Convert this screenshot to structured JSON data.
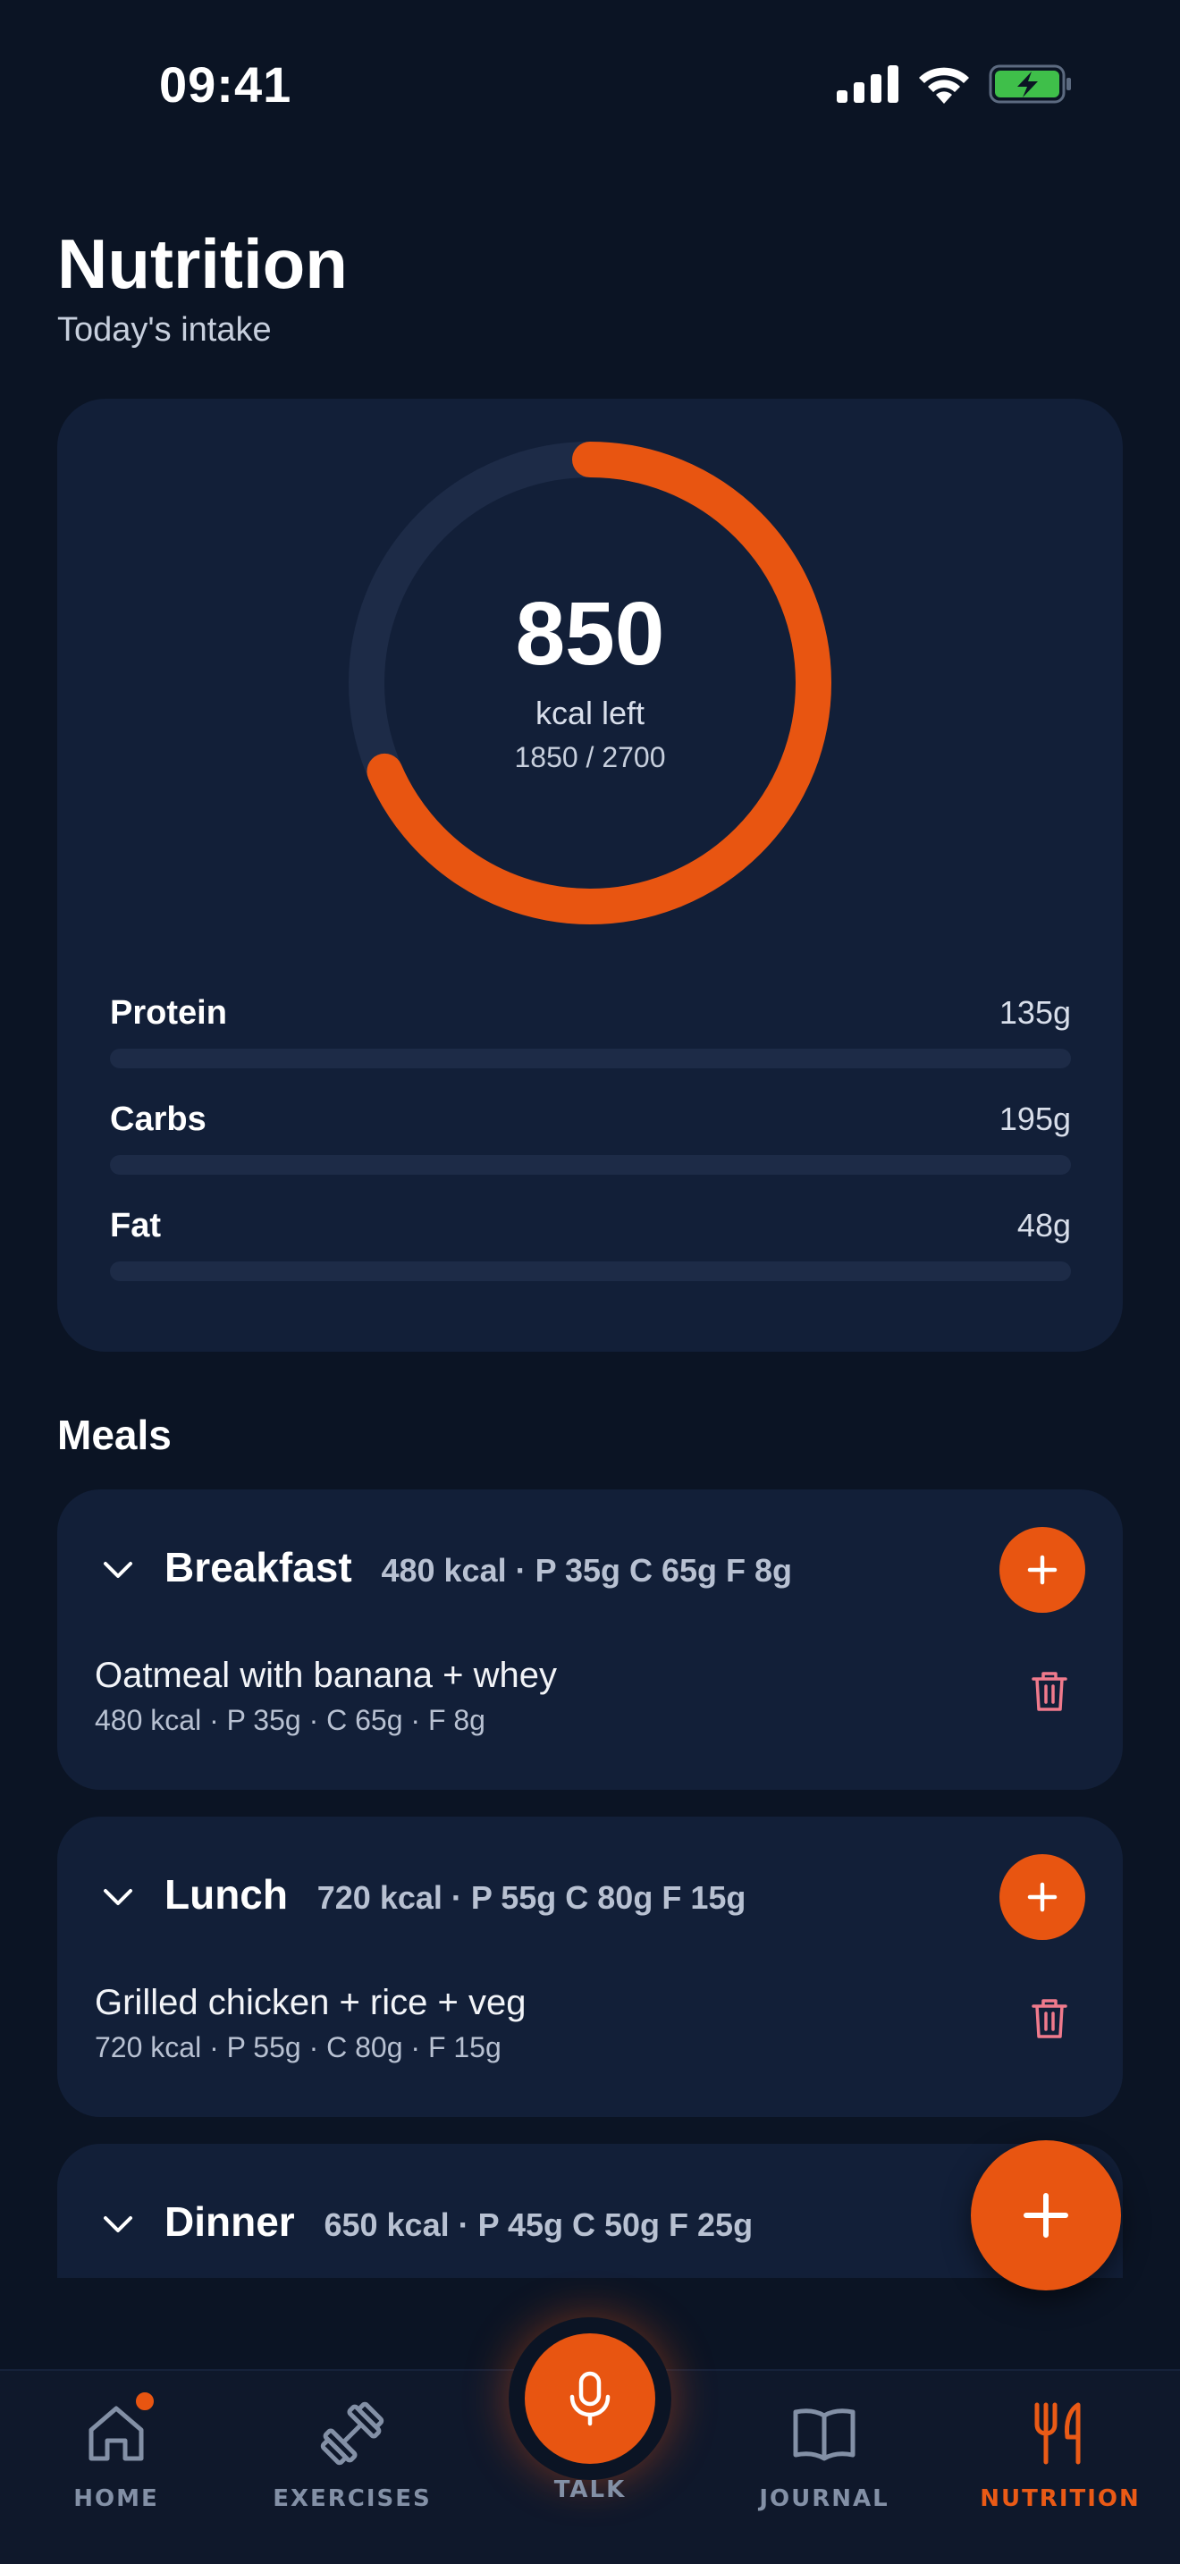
{
  "status_bar": {
    "time": "09:41"
  },
  "header": {
    "title": "Nutrition",
    "subtitle": "Today's intake"
  },
  "summary": {
    "kcal_left": "850",
    "kcal_left_label": "kcal left",
    "consumed_of_goal": "1850 / 2700",
    "consumed": 1850,
    "goal": 2700,
    "accent_color": "#e85511",
    "macros": [
      {
        "name": "Protein",
        "value": "135g",
        "progress": 0
      },
      {
        "name": "Carbs",
        "value": "195g",
        "progress": 0
      },
      {
        "name": "Fat",
        "value": "48g",
        "progress": 0
      }
    ]
  },
  "meals_section": {
    "title": "Meals"
  },
  "meals": [
    {
      "name": "Breakfast",
      "summary": "480 kcal · P 35g C 65g F 8g",
      "entries": [
        {
          "name": "Oatmeal with banana + whey",
          "detail": "480 kcal · P 35g · C 65g · F 8g"
        }
      ]
    },
    {
      "name": "Lunch",
      "summary": "720 kcal · P 55g C 80g F 15g",
      "entries": [
        {
          "name": "Grilled chicken + rice + veg",
          "detail": "720 kcal · P 55g · C 80g · F 15g"
        }
      ]
    },
    {
      "name": "Dinner",
      "summary": "650 kcal · P 45g C 50g F 25g",
      "entries": []
    }
  ],
  "tabs": [
    {
      "label": "HOME",
      "icon": "home-icon",
      "active": false,
      "badge": true
    },
    {
      "label": "EXERCISES",
      "icon": "dumbbell-icon",
      "active": false
    },
    {
      "label": "TALK",
      "icon": "microphone-icon",
      "active": false
    },
    {
      "label": "JOURNAL",
      "icon": "book-icon",
      "active": false
    },
    {
      "label": "NUTRITION",
      "icon": "fork-knife-icon",
      "active": true
    }
  ]
}
